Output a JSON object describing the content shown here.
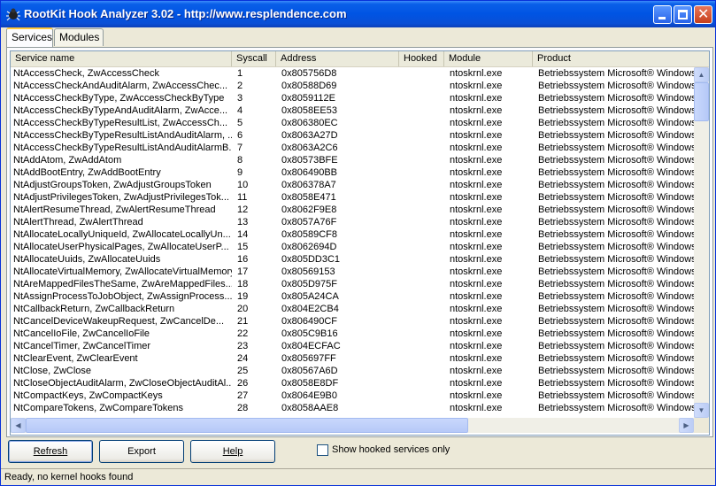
{
  "window": {
    "title": "RootKit Hook Analyzer 3.02 - http://www.resplendence.com"
  },
  "tabs": [
    {
      "label": "Services",
      "active": true
    },
    {
      "label": "Modules",
      "active": false
    }
  ],
  "table": {
    "columns": [
      "Service name",
      "Syscall",
      "Address",
      "Hooked",
      "Module",
      "Product"
    ],
    "rows": [
      [
        "NtAccessCheck, ZwAccessCheck",
        "1",
        "0x805756D8",
        "",
        "ntoskrnl.exe",
        "Betriebssystem Microsoft® Windows®"
      ],
      [
        "NtAccessCheckAndAuditAlarm, ZwAccessChec...",
        "2",
        "0x80588D69",
        "",
        "ntoskrnl.exe",
        "Betriebssystem Microsoft® Windows®"
      ],
      [
        "NtAccessCheckByType, ZwAccessCheckByType",
        "3",
        "0x8059112E",
        "",
        "ntoskrnl.exe",
        "Betriebssystem Microsoft® Windows®"
      ],
      [
        "NtAccessCheckByTypeAndAuditAlarm, ZwAcce...",
        "4",
        "0x8058EE53",
        "",
        "ntoskrnl.exe",
        "Betriebssystem Microsoft® Windows®"
      ],
      [
        "NtAccessCheckByTypeResultList, ZwAccessCh...",
        "5",
        "0x806380EC",
        "",
        "ntoskrnl.exe",
        "Betriebssystem Microsoft® Windows®"
      ],
      [
        "NtAccessCheckByTypeResultListAndAuditAlarm, ...",
        "6",
        "0x8063A27D",
        "",
        "ntoskrnl.exe",
        "Betriebssystem Microsoft® Windows®"
      ],
      [
        "NtAccessCheckByTypeResultListAndAuditAlarmB...",
        "7",
        "0x8063A2C6",
        "",
        "ntoskrnl.exe",
        "Betriebssystem Microsoft® Windows®"
      ],
      [
        "NtAddAtom, ZwAddAtom",
        "8",
        "0x80573BFE",
        "",
        "ntoskrnl.exe",
        "Betriebssystem Microsoft® Windows®"
      ],
      [
        "NtAddBootEntry, ZwAddBootEntry",
        "9",
        "0x806490BB",
        "",
        "ntoskrnl.exe",
        "Betriebssystem Microsoft® Windows®"
      ],
      [
        "NtAdjustGroupsToken, ZwAdjustGroupsToken",
        "10",
        "0x806378A7",
        "",
        "ntoskrnl.exe",
        "Betriebssystem Microsoft® Windows®"
      ],
      [
        "NtAdjustPrivilegesToken, ZwAdjustPrivilegesTok...",
        "11",
        "0x8058E471",
        "",
        "ntoskrnl.exe",
        "Betriebssystem Microsoft® Windows®"
      ],
      [
        "NtAlertResumeThread, ZwAlertResumeThread",
        "12",
        "0x8062F9E8",
        "",
        "ntoskrnl.exe",
        "Betriebssystem Microsoft® Windows®"
      ],
      [
        "NtAlertThread, ZwAlertThread",
        "13",
        "0x8057A76F",
        "",
        "ntoskrnl.exe",
        "Betriebssystem Microsoft® Windows®"
      ],
      [
        "NtAllocateLocallyUniqueId, ZwAllocateLocallyUn...",
        "14",
        "0x80589CF8",
        "",
        "ntoskrnl.exe",
        "Betriebssystem Microsoft® Windows®"
      ],
      [
        "NtAllocateUserPhysicalPages, ZwAllocateUserP...",
        "15",
        "0x8062694D",
        "",
        "ntoskrnl.exe",
        "Betriebssystem Microsoft® Windows®"
      ],
      [
        "NtAllocateUuids, ZwAllocateUuids",
        "16",
        "0x805DD3C1",
        "",
        "ntoskrnl.exe",
        "Betriebssystem Microsoft® Windows®"
      ],
      [
        "NtAllocateVirtualMemory, ZwAllocateVirtualMemory",
        "17",
        "0x80569153",
        "",
        "ntoskrnl.exe",
        "Betriebssystem Microsoft® Windows®"
      ],
      [
        "NtAreMappedFilesTheSame, ZwAreMappedFiles...",
        "18",
        "0x805D975F",
        "",
        "ntoskrnl.exe",
        "Betriebssystem Microsoft® Windows®"
      ],
      [
        "NtAssignProcessToJobObject, ZwAssignProcess...",
        "19",
        "0x805A24CA",
        "",
        "ntoskrnl.exe",
        "Betriebssystem Microsoft® Windows®"
      ],
      [
        "NtCallbackReturn, ZwCallbackReturn",
        "20",
        "0x804E2CB4",
        "",
        "ntoskrnl.exe",
        "Betriebssystem Microsoft® Windows®"
      ],
      [
        "NtCancelDeviceWakeupRequest, ZwCancelDe...",
        "21",
        "0x806490CF",
        "",
        "ntoskrnl.exe",
        "Betriebssystem Microsoft® Windows®"
      ],
      [
        "NtCancelIoFile, ZwCancelIoFile",
        "22",
        "0x805C9B16",
        "",
        "ntoskrnl.exe",
        "Betriebssystem Microsoft® Windows®"
      ],
      [
        "NtCancelTimer, ZwCancelTimer",
        "23",
        "0x804ECFAC",
        "",
        "ntoskrnl.exe",
        "Betriebssystem Microsoft® Windows®"
      ],
      [
        "NtClearEvent, ZwClearEvent",
        "24",
        "0x805697FF",
        "",
        "ntoskrnl.exe",
        "Betriebssystem Microsoft® Windows®"
      ],
      [
        "NtClose, ZwClose",
        "25",
        "0x80567A6D",
        "",
        "ntoskrnl.exe",
        "Betriebssystem Microsoft® Windows®"
      ],
      [
        "NtCloseObjectAuditAlarm, ZwCloseObjectAuditAl...",
        "26",
        "0x8058E8DF",
        "",
        "ntoskrnl.exe",
        "Betriebssystem Microsoft® Windows®"
      ],
      [
        "NtCompactKeys, ZwCompactKeys",
        "27",
        "0x8064E9B0",
        "",
        "ntoskrnl.exe",
        "Betriebssystem Microsoft® Windows®"
      ],
      [
        "NtCompareTokens, ZwCompareTokens",
        "28",
        "0x8058AAE8",
        "",
        "ntoskrnl.exe",
        "Betriebssystem Microsoft® Windows®"
      ]
    ]
  },
  "buttons": {
    "refresh": "Refresh",
    "export": "Export",
    "help": "Help"
  },
  "options": {
    "show_hooked_label": "Show hooked services only",
    "show_hooked_checked": false
  },
  "status": {
    "text": "Ready, no kernel hooks found"
  }
}
